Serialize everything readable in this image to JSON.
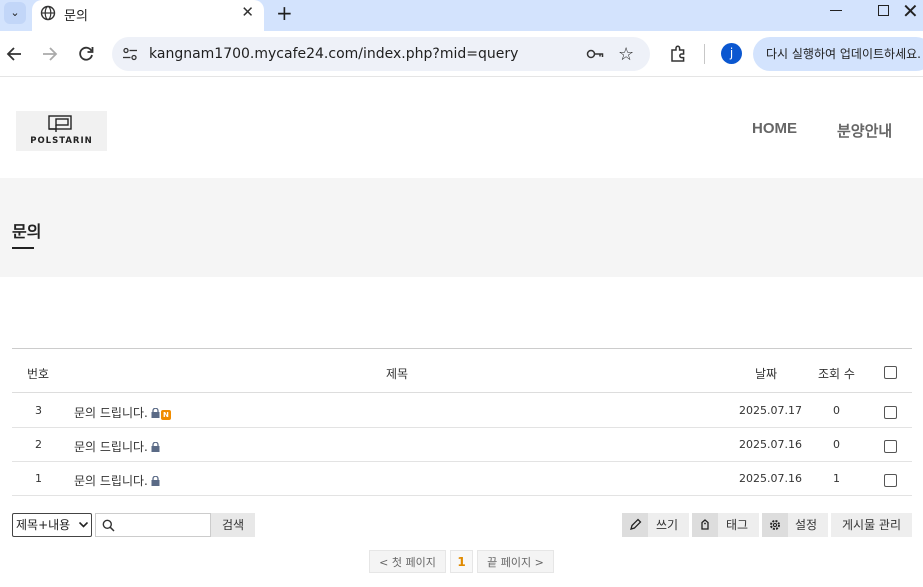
{
  "browser": {
    "tab_title": "문의",
    "tab_menu_glyph": "⌄",
    "close_glyph": "✕",
    "new_tab_glyph": "+",
    "win_close_glyph": "✕",
    "star_glyph": "☆",
    "url": "kangnam1700.mycafe24.com/index.php?mid=query",
    "profile_initial": "j",
    "update_label": "다시 실행하여 업데이트하세요."
  },
  "site": {
    "logo_text": "POLSTARIN",
    "nav": [
      "HOME",
      "분양안내"
    ],
    "page_title": "문의"
  },
  "board": {
    "headers": {
      "number": "번호",
      "subject": "제목",
      "date": "날짜",
      "views": "조회 수"
    },
    "rows": [
      {
        "number": "3",
        "subject": "문의 드립니다.",
        "secret": true,
        "is_new": true,
        "new_label": "N",
        "date": "2025.07.17",
        "views": "0"
      },
      {
        "number": "2",
        "subject": "문의 드립니다.",
        "secret": true,
        "is_new": false,
        "date": "2025.07.16",
        "views": "0"
      },
      {
        "number": "1",
        "subject": "문의 드립니다.",
        "secret": true,
        "is_new": false,
        "date": "2025.07.16",
        "views": "1"
      }
    ]
  },
  "search": {
    "target_selected": "제목+내용",
    "query": "",
    "button_label": "검색"
  },
  "actions": {
    "write_label": "쓰기",
    "tag_label": "태그",
    "settings_label": "설정",
    "manage_label": "게시물 관리"
  },
  "pagination": {
    "first_label": "< 첫 페이지",
    "current_page": "1",
    "last_label": "끝 페이지 >"
  },
  "colors": {
    "tab_strip": "#d3e3fd",
    "accent": "#0b57d0",
    "new_badge": "#f08c00",
    "current_page": "#e08a00"
  }
}
